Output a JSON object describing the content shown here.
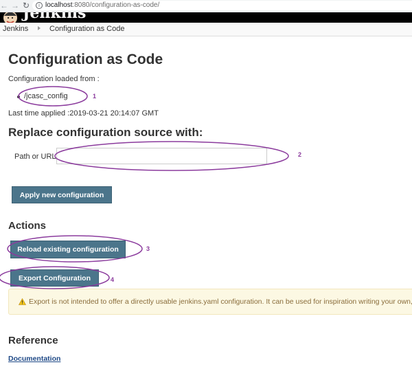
{
  "browser": {
    "url_host": "localhost",
    "url_path": ":8080/configuration-as-code/",
    "back_icon": "arrow-left",
    "forward_icon": "arrow-right",
    "reload_icon": "reload",
    "info_icon": "info-circle"
  },
  "header": {
    "logo_text": "Jenkins"
  },
  "breadcrumb": {
    "home": "Jenkins",
    "current": "Configuration as Code"
  },
  "main": {
    "title": "Configuration as Code",
    "loaded_from_label": "Configuration loaded from :",
    "sources": [
      "/jcasc_config"
    ],
    "last_applied": "Last time applied :2019-03-21 20:14:07 GMT",
    "replace_heading": "Replace configuration source with:",
    "path_label": "Path or URL",
    "path_value": "",
    "apply_button": "Apply new configuration",
    "actions_heading": "Actions",
    "reload_button": "Reload existing configuration",
    "export_button": "Export Configuration",
    "warning_text": "Export is not intended to offer a directly usable jenkins.yaml configuration. It can be used for inspiration writing your own,",
    "reference_heading": "Reference",
    "documentation_link": "Documentation"
  },
  "annotations": {
    "labels": [
      "1",
      "2",
      "3",
      "4"
    ],
    "color": "#8b3b9d"
  },
  "colors": {
    "button": "#4b758b",
    "warning_bg": "#fcf8e3",
    "warning_text": "#8a6d3b",
    "link": "#204a87"
  }
}
